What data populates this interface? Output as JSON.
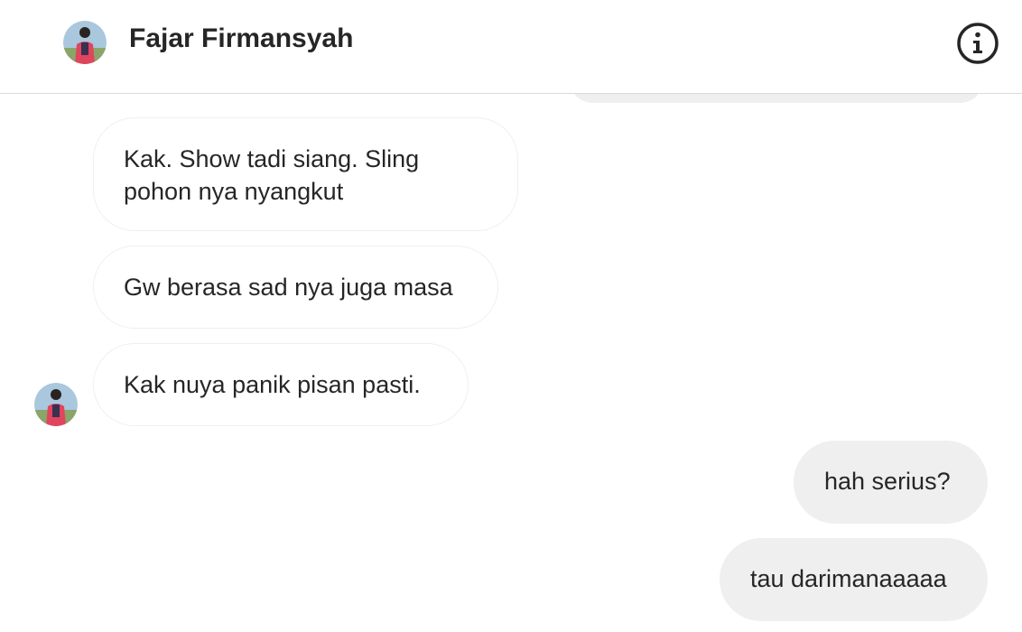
{
  "header": {
    "name": "Fajar Firmansyah",
    "avatar_icon": "user-avatar-icon",
    "info_icon": "info-icon"
  },
  "messages": [
    {
      "sender": "contact",
      "text": "Kak. Show tadi siang. Sling pohon nya nyangkut"
    },
    {
      "sender": "contact",
      "text": "Gw berasa sad nya juga masa"
    },
    {
      "sender": "contact",
      "text": "Kak nuya panik pisan pasti."
    },
    {
      "sender": "me",
      "text": "hah serius?"
    },
    {
      "sender": "me",
      "text": "tau darimanaaaaa"
    }
  ],
  "colors": {
    "outgoing_bubble": "#efefef",
    "incoming_border": "#efefef",
    "header_border": "#dbdbdb",
    "text": "#262626"
  }
}
